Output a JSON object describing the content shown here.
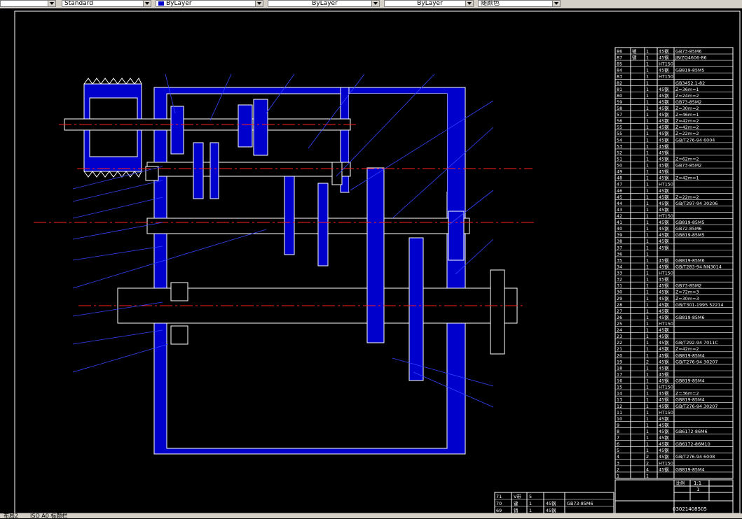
{
  "toolbar": {
    "textstyle": "Standard",
    "layer": "ByLayer",
    "linetype": "ByLayer",
    "lineweight": "ByLayer",
    "color": "随颜色"
  },
  "colors": {
    "canvas": "#000000",
    "part": "#0000cc",
    "line": "#ffffff",
    "center": "#ff2020",
    "leader": "#3344ff"
  },
  "bom_rows": [
    [
      "86",
      "销",
      "1",
      "45钢",
      "GB73-85M6"
    ],
    [
      "87",
      "键",
      "1",
      "45钢",
      "JB/ZQ4606-86"
    ],
    [
      "85",
      "",
      "1",
      "HT150",
      ""
    ],
    [
      "84",
      "",
      "1",
      "45钢",
      "GB819-85M5"
    ],
    [
      "83",
      "",
      "1",
      "HT150",
      ""
    ],
    [
      "82",
      "",
      "1",
      "",
      "GB3452.1-82"
    ],
    [
      "81",
      "",
      "1",
      "45钢",
      "Z=36m=1"
    ],
    [
      "80",
      "",
      "1",
      "45钢",
      "Z=24m=2"
    ],
    [
      "59",
      "",
      "1",
      "45钢",
      "GB73-85M2"
    ],
    [
      "58",
      "",
      "1",
      "45钢",
      "Z=30m=2"
    ],
    [
      "57",
      "",
      "1",
      "45钢",
      "Z=46m=1"
    ],
    [
      "56",
      "",
      "1",
      "45钢",
      "Z=42m=2"
    ],
    [
      "55",
      "",
      "1",
      "45钢",
      "Z=42m=2"
    ],
    [
      "55",
      "",
      "1",
      "45钢",
      "Z=22m=2"
    ],
    [
      "54",
      "",
      "1",
      "45钢",
      "GB/T276-94 6004"
    ],
    [
      "53",
      "",
      "1",
      "45钢",
      ""
    ],
    [
      "52",
      "",
      "1",
      "45钢",
      ""
    ],
    [
      "51",
      "",
      "1",
      "45钢",
      "Z=62m=2"
    ],
    [
      "50",
      "",
      "1",
      "45钢",
      "GB73-85M2"
    ],
    [
      "49",
      "",
      "1",
      "45钢",
      ""
    ],
    [
      "48",
      "",
      "1",
      "45钢",
      "Z=42m=1"
    ],
    [
      "47",
      "",
      "1",
      "HT150",
      ""
    ],
    [
      "46",
      "",
      "1",
      "45钢",
      ""
    ],
    [
      "45",
      "",
      "1",
      "45钢",
      "Z=22m=2"
    ],
    [
      "44",
      "",
      "1",
      "45钢",
      "GB/T297-94 30206"
    ],
    [
      "43",
      "",
      "1",
      "45钢",
      ""
    ],
    [
      "42",
      "",
      "1",
      "HT150",
      ""
    ],
    [
      "41",
      "",
      "1",
      "45钢",
      "GB819-85M5"
    ],
    [
      "40",
      "",
      "1",
      "45钢",
      "GB72-85M6"
    ],
    [
      "39",
      "",
      "1",
      "45钢",
      "GB819-85M5"
    ],
    [
      "38",
      "",
      "1",
      "45钢",
      ""
    ],
    [
      "37",
      "",
      "1",
      "45钢",
      ""
    ],
    [
      "36",
      "",
      "1",
      "",
      ""
    ],
    [
      "35",
      "",
      "1",
      "45钢",
      "GB819-85M6"
    ],
    [
      "34",
      "",
      "1",
      "45钢",
      "GB/T283-94 NN3014"
    ],
    [
      "33",
      "",
      "1",
      "HT150",
      ""
    ],
    [
      "32",
      "",
      "1",
      "45钢",
      ""
    ],
    [
      "31",
      "",
      "1",
      "45钢",
      "GB73-85M2"
    ],
    [
      "30",
      "",
      "1",
      "45钢",
      "Z=72m=3"
    ],
    [
      "29",
      "",
      "1",
      "45钢",
      "Z=30m=3"
    ],
    [
      "28",
      "",
      "1",
      "45钢",
      "GB/T301-1995 52214"
    ],
    [
      "27",
      "",
      "1",
      "45钢",
      ""
    ],
    [
      "26",
      "",
      "1",
      "45钢",
      "GB819-85M6"
    ],
    [
      "25",
      "",
      "1",
      "HT150",
      ""
    ],
    [
      "24",
      "",
      "1",
      "45钢",
      ""
    ],
    [
      "23",
      "",
      "1",
      "45钢",
      ""
    ],
    [
      "22",
      "",
      "1",
      "45钢",
      "GB/T292-94 7011C"
    ],
    [
      "21",
      "",
      "1",
      "45钢",
      "Z=42m=2"
    ],
    [
      "20",
      "",
      "1",
      "45钢",
      "GB819-85M4"
    ],
    [
      "19",
      "",
      "2",
      "45钢",
      "GB/T276-94 30207"
    ],
    [
      "18",
      "",
      "1",
      "45钢",
      ""
    ],
    [
      "17",
      "",
      "1",
      "45钢",
      ""
    ],
    [
      "16",
      "",
      "1",
      "45钢",
      "GB819-85M4"
    ],
    [
      "15",
      "",
      "1",
      "HT150",
      ""
    ],
    [
      "14",
      "",
      "1",
      "45钢",
      "Z=36m=2"
    ],
    [
      "13",
      "",
      "1",
      "45钢",
      "GB819-85M4"
    ],
    [
      "12",
      "",
      "1",
      "45钢",
      "GB/T276-94 30207"
    ],
    [
      "11",
      "",
      "1",
      "HT150",
      ""
    ],
    [
      "10",
      "",
      "1",
      "45钢",
      ""
    ],
    [
      "9",
      "",
      "1",
      "45钢",
      ""
    ],
    [
      "8",
      "",
      "1",
      "45钢",
      "GB6172-86M6"
    ],
    [
      "7",
      "",
      "1",
      "45钢",
      ""
    ],
    [
      "6",
      "",
      "1",
      "45钢",
      "GB6172-86M10"
    ],
    [
      "5",
      "",
      "1",
      "45钢",
      ""
    ],
    [
      "4",
      "",
      "2",
      "45钢",
      "GB/T276-94 6008"
    ],
    [
      "3",
      "",
      "2",
      "HT150",
      ""
    ],
    [
      "2",
      "",
      "4",
      "45钢",
      "GB819-85M4"
    ],
    [
      "1",
      "",
      "1",
      "",
      ""
    ]
  ],
  "bom_bottom_rows": [
    [
      "71",
      "V带",
      "5",
      "",
      ""
    ],
    [
      "70",
      "键",
      "1",
      "45钢",
      "GB73-85M6"
    ],
    [
      "69",
      "销",
      "1",
      "45钢",
      ""
    ]
  ],
  "title_block": {
    "scale_label": "比例",
    "scale_value": "1:1",
    "sheet_value": "1",
    "drawing_no": "03021408505"
  },
  "tabs": {
    "model": "布局2",
    "iso": "ISO A0 标题栏"
  }
}
